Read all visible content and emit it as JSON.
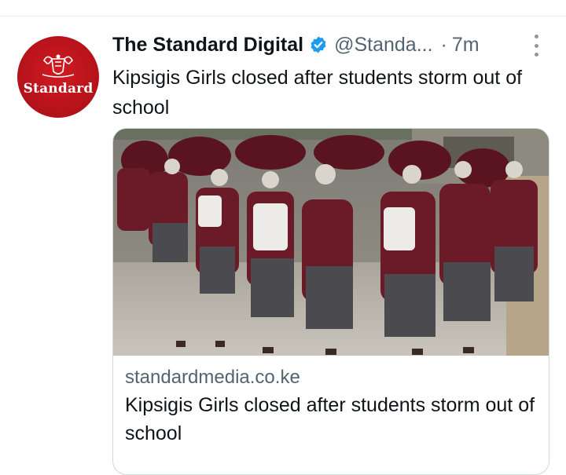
{
  "tweet": {
    "author_name": "The Standard Digital",
    "handle": "@Standa...",
    "separator": "·",
    "time": "7m",
    "text": "Kipsigis Girls closed after students storm out of school",
    "verified_color": "#1d9bf0"
  },
  "avatar": {
    "wordmark": "Standard",
    "background": "#c0161e"
  },
  "card": {
    "domain": "standardmedia.co.ke",
    "title": "Kipsigis Girls closed after students storm out of school",
    "image_description_icon": "photo-image"
  },
  "colors": {
    "text_primary": "#0f1419",
    "text_secondary": "#536471",
    "border": "#cfd9de"
  }
}
